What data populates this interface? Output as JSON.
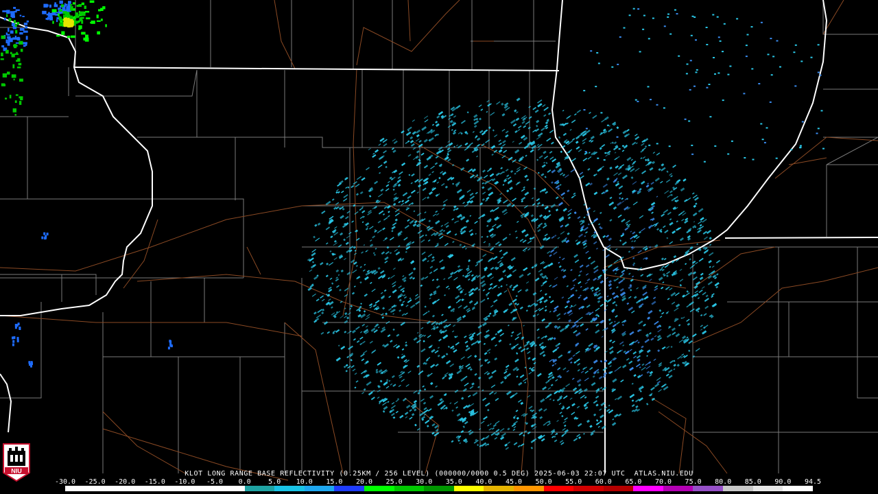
{
  "product_title": "KLOT LONG RANGE BASE REFLECTIVITY (0.25KM / 256 LEVEL) (000000/0000 0.5 DEG) 2025-06-03 22:07 UTC  ATLAS.NIU.EDU",
  "logo_text": "NIU",
  "colorbar": {
    "ticks": [
      "-30.0",
      "-25.0",
      "-20.0",
      "-15.0",
      "-10.0",
      "-5.0",
      "0.0",
      "5.0",
      "10.0",
      "15.0",
      "20.0",
      "25.0",
      "30.0",
      "35.0",
      "40.0",
      "45.0",
      "50.0",
      "55.0",
      "60.0",
      "65.0",
      "70.0",
      "75.0",
      "80.0",
      "85.0",
      "90.0",
      "94.5"
    ],
    "colors": [
      "#ffffff",
      "#ffffff",
      "#ffffff",
      "#ffffff",
      "#ffffff",
      "#ffffff",
      "#1fa3a3",
      "#19c3e6",
      "#1ea7f0",
      "#1e3cff",
      "#00ff00",
      "#00c800",
      "#009600",
      "#ffff00",
      "#e6b400",
      "#ff9600",
      "#ff0000",
      "#d20000",
      "#b40000",
      "#ff00ff",
      "#b400b4",
      "#9650c8",
      "#c8c8c8",
      "#e6e6e6",
      "#ffffff"
    ]
  },
  "colors": {
    "background": "#000000",
    "state_border": "#ffffff",
    "county_border": "#808080",
    "road": "#8b4513",
    "echo": "#2ac8e8",
    "echo_strong": "#3a8cf0"
  }
}
